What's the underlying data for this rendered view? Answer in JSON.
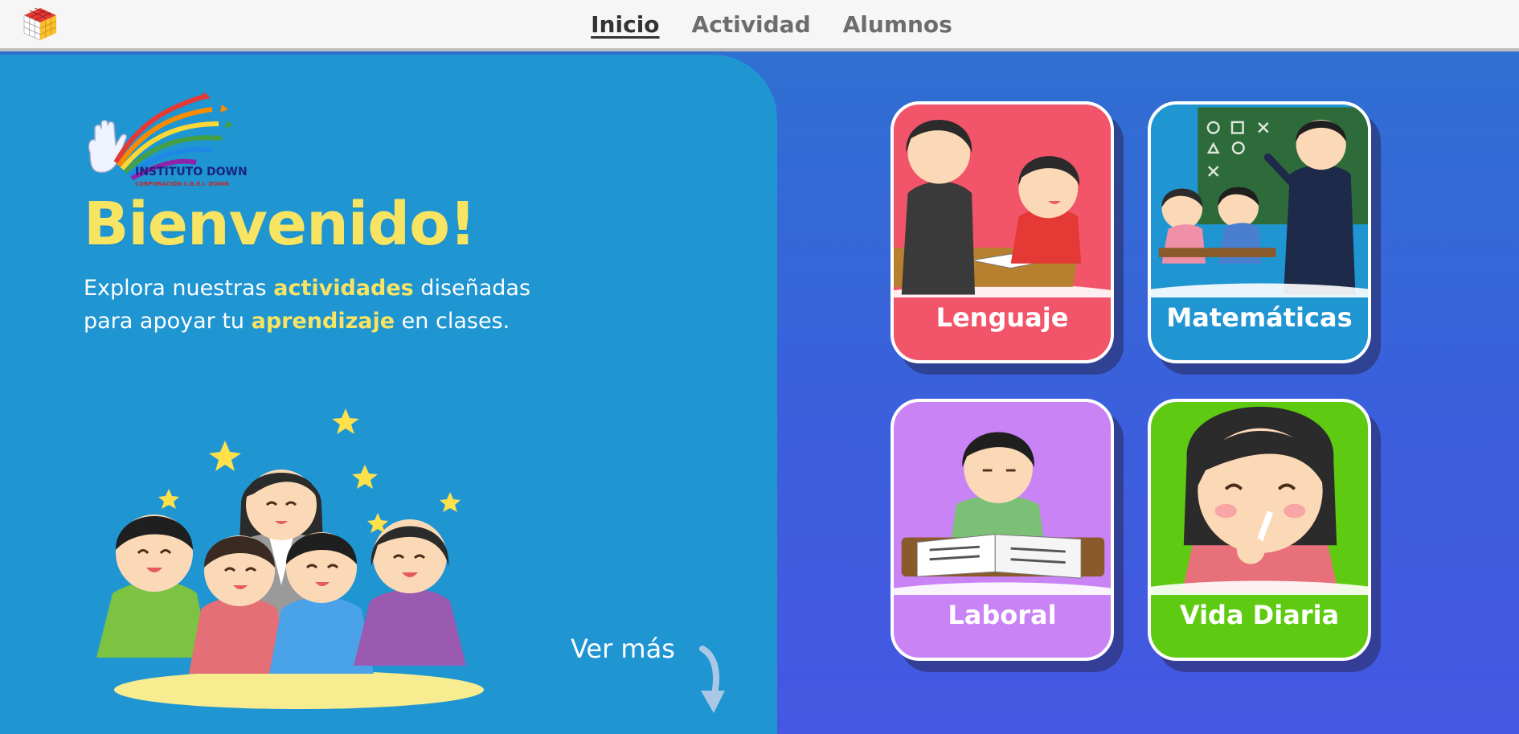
{
  "nav": {
    "items": [
      {
        "label": "Inicio",
        "active": true
      },
      {
        "label": "Actividad",
        "active": false
      },
      {
        "label": "Alumnos",
        "active": false
      }
    ]
  },
  "hero": {
    "logo_text": "INSTITUTO DOWN",
    "logo_subtext": "CORPORACIÓN C.R.E.I. DOWN",
    "title": "Bienvenido!",
    "desc_part1": "Explora nuestras ",
    "desc_hl1": "actividades",
    "desc_part2": " diseñadas para apoyar tu ",
    "desc_hl2": "aprendizaje",
    "desc_part3": " en clases.",
    "ver_mas": "Ver más"
  },
  "cards": [
    {
      "label": "Lenguaje",
      "color": "#f2556a"
    },
    {
      "label": "Matemáticas",
      "color": "#1f95d2"
    },
    {
      "label": "Laboral",
      "color": "#c983f5"
    },
    {
      "label": "Vida Diaria",
      "color": "#5ecb12"
    }
  ],
  "colors": {
    "hero_bg": "#1f95d2",
    "accent_yellow": "#f7e463",
    "page_bg": "#3f59e0",
    "topbar_bg": "#f6f6f6"
  },
  "icons": {
    "app_logo": "rubiks-cube-icon",
    "scroll": "arrow-down-icon"
  }
}
